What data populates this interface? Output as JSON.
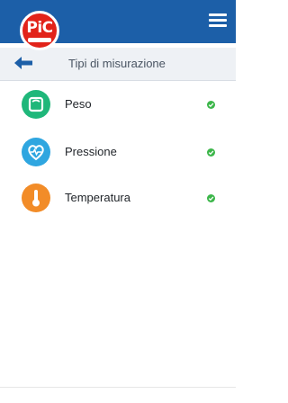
{
  "header": {
    "logo_text": "PiC",
    "menu_icon": "hamburger-menu-icon",
    "bar_color": "#1c5fa8"
  },
  "subheader": {
    "back_icon": "arrow-left-icon",
    "title": "Tipi di misurazione"
  },
  "measurements": [
    {
      "label": "Peso",
      "icon": "scale-icon",
      "color": "#1fb77a",
      "status_icon": "check-icon",
      "status_color": "#3cb64a"
    },
    {
      "label": "Pressione",
      "icon": "heart-pulse-icon",
      "color": "#2fa6e0",
      "status_icon": "check-icon",
      "status_color": "#3cb64a"
    },
    {
      "label": "Temperatura",
      "icon": "thermometer-icon",
      "color": "#f28c28",
      "status_icon": "check-icon",
      "status_color": "#3cb64a"
    }
  ]
}
